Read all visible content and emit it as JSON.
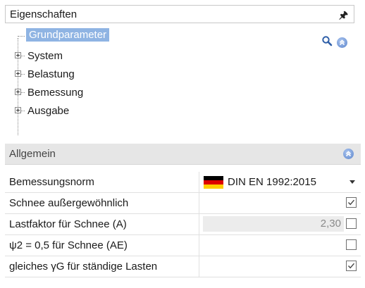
{
  "panel": {
    "title": "Eigenschaften",
    "pin_icon": "pin-icon"
  },
  "tree": {
    "items": [
      {
        "label": "Grundparameter",
        "selected": true,
        "expandable": false
      },
      {
        "label": "System",
        "selected": false,
        "expandable": true
      },
      {
        "label": "Belastung",
        "selected": false,
        "expandable": true
      },
      {
        "label": "Bemessung",
        "selected": false,
        "expandable": true
      },
      {
        "label": "Ausgabe",
        "selected": false,
        "expandable": true
      }
    ],
    "tools": {
      "search_icon": "search-icon",
      "collapse_icon": "collapse-up-icon"
    }
  },
  "section": {
    "title": "Allgemein",
    "collapse_icon": "collapse-up-icon"
  },
  "properties": [
    {
      "name": "Bemessungsnorm",
      "value": "DIN EN 1992:2015",
      "type": "dropdown",
      "flag": "germany-flag-icon"
    },
    {
      "name": "Schnee außergewöhnlich",
      "checked": true,
      "type": "checkbox"
    },
    {
      "name": "Lastfaktor für Schnee (A)",
      "value": "2,30",
      "checked": false,
      "type": "value-checkbox"
    },
    {
      "name": "ψ2 = 0,5 für Schnee (AE)",
      "checked": false,
      "type": "checkbox"
    },
    {
      "name": "gleiches γG für ständige Lasten",
      "checked": true,
      "type": "checkbox"
    }
  ],
  "colors": {
    "selection": "#8fb4e3",
    "section_bg": "#e6e6e6",
    "flag": [
      "#000000",
      "#dd0000",
      "#ffce00"
    ]
  }
}
